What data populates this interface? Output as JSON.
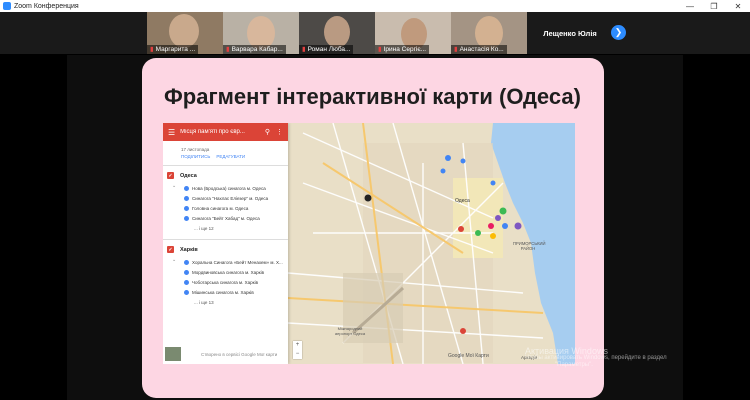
{
  "window": {
    "title": "Zoom Конференция",
    "controls": [
      "minimize-icon",
      "restore-icon",
      "close-icon"
    ]
  },
  "participants": [
    {
      "name": "Маргарита ...",
      "muted": true
    },
    {
      "name": "Варвара Кабар...",
      "muted": true
    },
    {
      "name": "Роман Люба...",
      "muted": true
    },
    {
      "name": "Ірина Сергіє...",
      "muted": true
    },
    {
      "name": "Анастасія Ко...",
      "muted": true
    }
  ],
  "active_speaker": "Лещенко Юлія",
  "slide": {
    "title": "Фрагмент інтерактивної карти (Одеса)"
  },
  "map": {
    "panel_title": "Місця пам'яті про євр...",
    "date": "17 листопада",
    "share": "ПОДІЛИТИСЬ",
    "edit": "РЕДАГУВАТИ",
    "layers": [
      {
        "name": "Одеса",
        "items": [
          "Нова (Бродська) синагога м. Одеса",
          "Синагога \"Нахлас Еліезер\" м. Одеса",
          "Головна синагога м. Одеса",
          "Синагога \"Бейт Хабад\" м. Одеса"
        ],
        "more": "... і ще 12"
      },
      {
        "name": "Харків",
        "items": [
          "Хоральна Синагога «Бейт Менахем» м. Х...",
          "Мордвиновська синагога м. Харків",
          "Чоботарська синагога м. Харків",
          "Мішинська синагога м. Харків"
        ],
        "more": "... і ще 13"
      }
    ],
    "footer": "Створено в сервісі Google Мої карти",
    "zoom_in": "+",
    "zoom_out": "−",
    "labels": {
      "odesa": "Одеса",
      "district": "ПРИМОРСЬКИЙ РАЙОН",
      "district_line2": "РАЙОН",
      "airport": "Міжнародний аеропорт Одеса",
      "google": "Google Мої Карти",
      "arkadia": "Аркадія"
    }
  },
  "windows_watermark": {
    "line1": "Активация Windows",
    "line2": "Чтобы активировать Windows, перейдите в раздел",
    "line3": "\"Параметры\"."
  }
}
